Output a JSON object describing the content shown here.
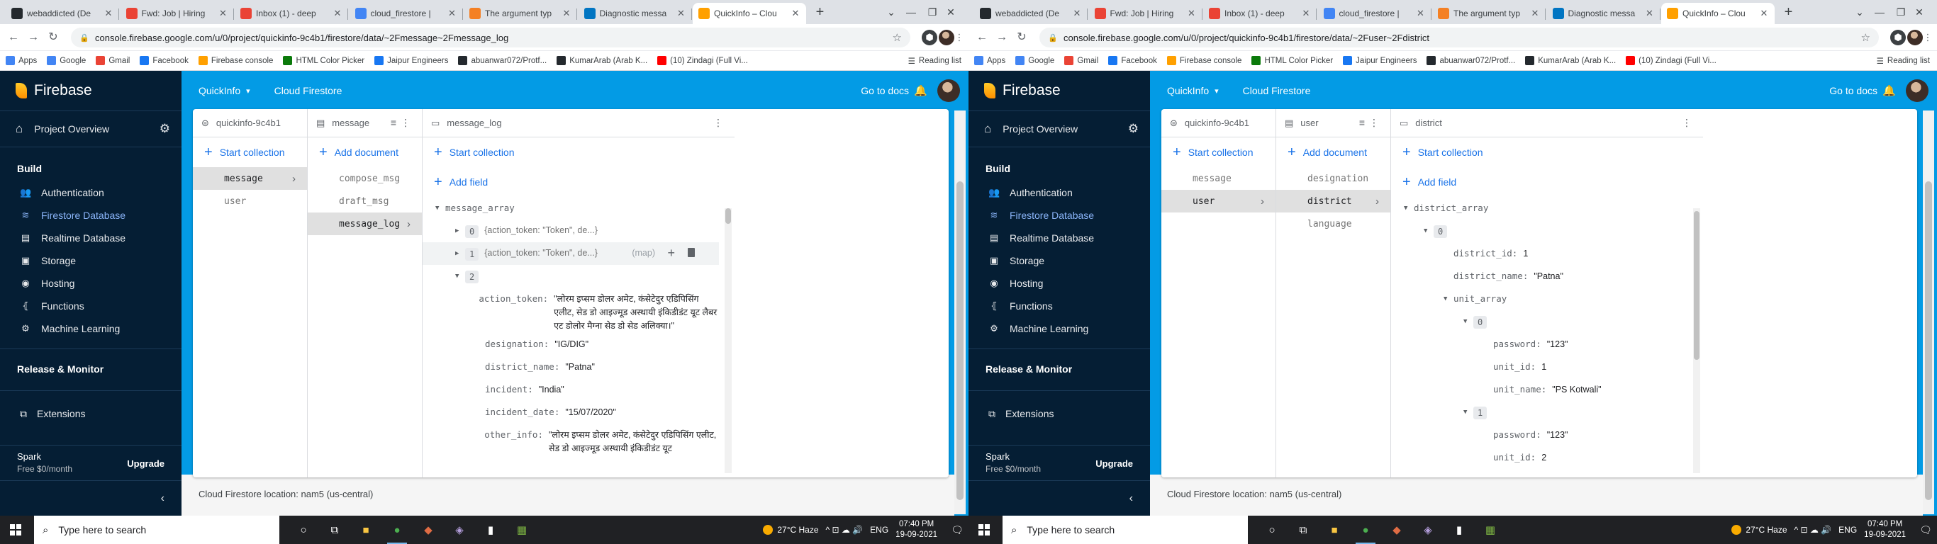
{
  "windows": [
    {
      "tabs": [
        {
          "title": "webaddicted (De",
          "color": "#24292e"
        },
        {
          "title": "Fwd: Job | Hiring",
          "color": "#ea4335"
        },
        {
          "title": "Inbox (1) - deep",
          "color": "#ea4335"
        },
        {
          "title": "cloud_firestore |",
          "color": "#4285f4"
        },
        {
          "title": "The argument typ",
          "color": "#f48024"
        },
        {
          "title": "Diagnostic messa",
          "color": "#0175c2"
        },
        {
          "title": "QuickInfo – Clou",
          "color": "#ffa000"
        }
      ],
      "url": "console.firebase.google.com/u/0/project/quickinfo-9c4b1/firestore/data/~2Fmessage~2Fmessage_log",
      "root_label": "quickinfo-9c4b1",
      "col2_title": "message",
      "col3_title": "message_log",
      "collections": [
        {
          "label": "message",
          "selected": true
        },
        {
          "label": "user",
          "selected": false
        }
      ],
      "documents": [
        {
          "label": "compose_msg",
          "selected": false
        },
        {
          "label": "draft_msg",
          "selected": false
        },
        {
          "label": "message_log",
          "selected": true
        }
      ],
      "fields": [
        {
          "indent": 0,
          "tri": "▼",
          "key": "message_array",
          "value": ""
        },
        {
          "indent": 1,
          "tri": "▶",
          "key": "",
          "badge": "0",
          "value": "",
          "map": "{action_token: \"Token\", de...}"
        },
        {
          "indent": 1,
          "tri": "▶",
          "key": "",
          "badge": "1",
          "value": "",
          "map": "{action_token: \"Token\", de...}",
          "maptype": "(map)",
          "highlight": true
        },
        {
          "indent": 1,
          "tri": "▼",
          "key": "",
          "badge": "2",
          "value": ""
        },
        {
          "indent": 2,
          "tri": "",
          "key": "action_token:",
          "value": "\"लोरम इप्सम डोलर अमेट, कंसेटेदुर एडिपिसिंग एलीट, सेड डो आइज्मूड अस्थायी इंकिडीडंट यूट लैबर एट डोलोर मैग्ना सेड डो सेड अलिक्या।\""
        },
        {
          "indent": 2,
          "tri": "",
          "key": "designation:",
          "value": "\"IG/DIG\""
        },
        {
          "indent": 2,
          "tri": "",
          "key": "district_name:",
          "value": "\"Patna\""
        },
        {
          "indent": 2,
          "tri": "",
          "key": "incident:",
          "value": "\"India\""
        },
        {
          "indent": 2,
          "tri": "",
          "key": "incident_date:",
          "value": "\"15/07/2020\""
        },
        {
          "indent": 2,
          "tri": "",
          "key": "other_info:",
          "value": "\"लोरम इप्सम डोलर अमेट, कंसेटेदुर एडिपिसिंग एलीट, सेड डो आइज्मूड अस्थायी इंकिडीडंट यूट"
        }
      ],
      "time": "07:40 PM",
      "date": "19-09-2021"
    },
    {
      "tabs": [
        {
          "title": "webaddicted (De",
          "color": "#24292e"
        },
        {
          "title": "Fwd: Job | Hiring",
          "color": "#ea4335"
        },
        {
          "title": "Inbox (1) - deep",
          "color": "#ea4335"
        },
        {
          "title": "cloud_firestore |",
          "color": "#4285f4"
        },
        {
          "title": "The argument typ",
          "color": "#f48024"
        },
        {
          "title": "Diagnostic messa",
          "color": "#0175c2"
        },
        {
          "title": "QuickInfo – Clou",
          "color": "#ffa000"
        }
      ],
      "url": "console.firebase.google.com/u/0/project/quickinfo-9c4b1/firestore/data/~2Fuser~2Fdistrict",
      "root_label": "quickinfo-9c4b1",
      "col2_title": "user",
      "col3_title": "district",
      "collections": [
        {
          "label": "message",
          "selected": false
        },
        {
          "label": "user",
          "selected": true
        }
      ],
      "documents": [
        {
          "label": "designation",
          "selected": false
        },
        {
          "label": "district",
          "selected": true
        },
        {
          "label": "language",
          "selected": false
        }
      ],
      "fields": [
        {
          "indent": 0,
          "tri": "▼",
          "key": "district_array",
          "value": ""
        },
        {
          "indent": 1,
          "tri": "▼",
          "key": "",
          "badge": "0",
          "value": ""
        },
        {
          "indent": 2,
          "tri": "",
          "key": "district_id:",
          "value": "1"
        },
        {
          "indent": 2,
          "tri": "",
          "key": "district_name:",
          "value": "\"Patna\""
        },
        {
          "indent": 2,
          "tri": "▼",
          "key": "unit_array",
          "value": ""
        },
        {
          "indent": 3,
          "tri": "▼",
          "key": "",
          "badge": "0",
          "value": ""
        },
        {
          "indent": 4,
          "tri": "",
          "key": "password:",
          "value": "\"123\""
        },
        {
          "indent": 4,
          "tri": "",
          "key": "unit_id:",
          "value": "1"
        },
        {
          "indent": 4,
          "tri": "",
          "key": "unit_name:",
          "value": "\"PS Kotwali\""
        },
        {
          "indent": 3,
          "tri": "▼",
          "key": "",
          "badge": "1",
          "value": ""
        },
        {
          "indent": 4,
          "tri": "",
          "key": "password:",
          "value": "\"123\""
        },
        {
          "indent": 4,
          "tri": "",
          "key": "unit_id:",
          "value": "2"
        }
      ],
      "time": "07:40 PM",
      "date": "19-09-2021"
    }
  ],
  "bookmarks": [
    {
      "label": "Apps",
      "color": "#4285f4"
    },
    {
      "label": "Google",
      "color": "#4285f4"
    },
    {
      "label": "Gmail",
      "color": "#ea4335"
    },
    {
      "label": "Facebook",
      "color": "#1877f2"
    },
    {
      "label": "Firebase console",
      "color": "#ffa000"
    },
    {
      "label": "HTML Color Picker",
      "color": "#0b7a0b"
    },
    {
      "label": "Jaipur Engineers",
      "color": "#1877f2"
    },
    {
      "label": "abuanwar072/Protf...",
      "color": "#24292e"
    },
    {
      "label": "KumarArab (Arab K...",
      "color": "#24292e"
    },
    {
      "label": "(10) Zindagi (Full Vi...",
      "color": "#ff0000"
    }
  ],
  "reading_list": "Reading list",
  "firebase": {
    "brand": "Firebase",
    "project_overview": "Project Overview",
    "build_heading": "Build",
    "build_items": [
      {
        "label": "Authentication",
        "icon": "people-icon",
        "glyph": "👥",
        "selected": false
      },
      {
        "label": "Firestore Database",
        "icon": "firestore-icon",
        "glyph": "≋",
        "selected": true
      },
      {
        "label": "Realtime Database",
        "icon": "database-icon",
        "glyph": "▤",
        "selected": false
      },
      {
        "label": "Storage",
        "icon": "storage-icon",
        "glyph": "▣",
        "selected": false
      },
      {
        "label": "Hosting",
        "icon": "hosting-icon",
        "glyph": "◉",
        "selected": false
      },
      {
        "label": "Functions",
        "icon": "functions-icon",
        "glyph": "⦃",
        "selected": false
      },
      {
        "label": "Machine Learning",
        "icon": "robot-icon",
        "glyph": "⚙",
        "selected": false
      }
    ],
    "release_heading": "Release & Monitor",
    "extensions": "Extensions",
    "plan": "Spark",
    "plan_price": "Free $0/month",
    "upgrade": "Upgrade",
    "project_name": "QuickInfo",
    "product": "Cloud Firestore",
    "go_to_docs": "Go to docs",
    "start_collection": "Start collection",
    "add_document": "Add document",
    "add_field": "Add field",
    "location": "Cloud Firestore location: nam5 (us-central)"
  },
  "taskbar": {
    "search_placeholder": "Type here to search",
    "weather": "27°C  Haze",
    "lang": "ENG"
  }
}
